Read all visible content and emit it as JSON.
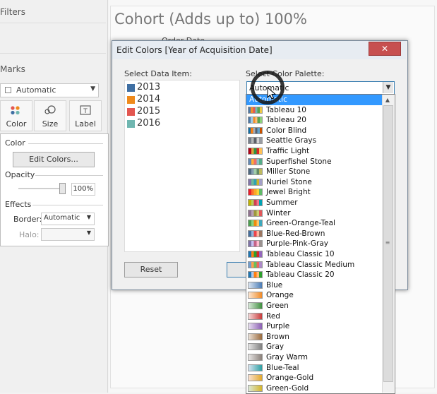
{
  "left_pane": {
    "filters_title": "Filters",
    "marks_title": "Marks",
    "mark_type": "Automatic",
    "mark_buttons": [
      "Color",
      "Size",
      "Label"
    ],
    "color_popup": {
      "color_label": "Color",
      "edit_colors": "Edit Colors...",
      "opacity_label": "Opacity",
      "opacity_value": "100%",
      "opacity_level": 1.0,
      "effects_label": "Effects",
      "border_label": "Border:",
      "border_value": "Automatic",
      "halo_label": "Halo:",
      "halo_value": ""
    }
  },
  "view": {
    "title": "Cohort (Adds up to) 100%",
    "subtitle": "Order Date"
  },
  "dialog": {
    "title": "Edit Colors [Year of Acquisition Date]",
    "close": "✕",
    "select_data_item_label": "Select Data Item:",
    "data_items": [
      {
        "label": "2013",
        "color": "#3f6fa3"
      },
      {
        "label": "2014",
        "color": "#ef8a1b"
      },
      {
        "label": "2015",
        "color": "#e35650"
      },
      {
        "label": "2016",
        "color": "#6fb6b0"
      }
    ],
    "select_palette_label": "Select Color Palette:",
    "palette_value": "Automatic",
    "reset": "Reset",
    "palette_options": [
      {
        "label": "Automatic",
        "colors": [],
        "selected": true
      },
      {
        "label": "Tableau 10",
        "colors": [
          "#4e79a7",
          "#f28e2b",
          "#e15759",
          "#76b7b2",
          "#59a14f",
          "#edc948"
        ]
      },
      {
        "label": "Tableau 20",
        "colors": [
          "#4e79a7",
          "#a0cbe8",
          "#f28e2b",
          "#ffbe7d",
          "#59a14f",
          "#8cd17d"
        ]
      },
      {
        "label": "Color Blind",
        "colors": [
          "#1170aa",
          "#fc7d0b",
          "#a3acb9",
          "#57606c",
          "#5fa2ce",
          "#c85200"
        ]
      },
      {
        "label": "Seattle Grays",
        "colors": [
          "#767f8b",
          "#b3b7b8",
          "#5c6068",
          "#d3d3d3",
          "#989ca3"
        ]
      },
      {
        "label": "Traffic Light",
        "colors": [
          "#b10318",
          "#dba13a",
          "#309343",
          "#d82526",
          "#ffc156"
        ]
      },
      {
        "label": "Superfishel Stone",
        "colors": [
          "#6388b4",
          "#ffae34",
          "#ef6f6a",
          "#8cc2ca",
          "#55ad89"
        ]
      },
      {
        "label": "Miller Stone",
        "colors": [
          "#4f6980",
          "#849db1",
          "#a2ceaa",
          "#638b66",
          "#bfbb60"
        ]
      },
      {
        "label": "Nuriel Stone",
        "colors": [
          "#8175aa",
          "#6fb899",
          "#31a1b3",
          "#ccb22b",
          "#a39fc9"
        ]
      },
      {
        "label": "Jewel Bright",
        "colors": [
          "#eb1e2c",
          "#fd6f30",
          "#f9a729",
          "#f9d23c",
          "#5fbb68"
        ]
      },
      {
        "label": "Summer",
        "colors": [
          "#bfb202",
          "#b9ca5d",
          "#cf3e53",
          "#f1788d",
          "#00a2b3"
        ]
      },
      {
        "label": "Winter",
        "colors": [
          "#90728f",
          "#b9a0b4",
          "#9d983d",
          "#cecb76",
          "#e15759"
        ]
      },
      {
        "label": "Green-Orange-Teal",
        "colors": [
          "#4e9f50",
          "#87d180",
          "#ef8a0c",
          "#fcc66d",
          "#3ca8bc"
        ]
      },
      {
        "label": "Blue-Red-Brown",
        "colors": [
          "#466f9d",
          "#91b3d7",
          "#ed444a",
          "#feb5a2",
          "#9d7660"
        ]
      },
      {
        "label": "Purple-Pink-Gray",
        "colors": [
          "#8074a8",
          "#c6c1f0",
          "#c46487",
          "#ffbed1",
          "#9c9290"
        ]
      },
      {
        "label": "Tableau Classic 10",
        "colors": [
          "#1f77b4",
          "#ff7f0e",
          "#2ca02c",
          "#d62728",
          "#9467bd"
        ]
      },
      {
        "label": "Tableau Classic Medium",
        "colors": [
          "#729ece",
          "#ff9e4a",
          "#67bf5c",
          "#ed665d",
          "#ad8bc9"
        ]
      },
      {
        "label": "Tableau Classic 20",
        "colors": [
          "#1f77b4",
          "#aec7e8",
          "#ff7f0e",
          "#ffbb78",
          "#2ca02c"
        ]
      },
      {
        "label": "Blue",
        "colors": [
          "#4a7cb6",
          "#4a7cb6"
        ]
      },
      {
        "label": "Orange",
        "colors": [
          "#f08a26",
          "#f08a26"
        ]
      },
      {
        "label": "Green",
        "colors": [
          "#3f8f3f",
          "#3f8f3f"
        ]
      },
      {
        "label": "Red",
        "colors": [
          "#c93b3b",
          "#c93b3b"
        ]
      },
      {
        "label": "Purple",
        "colors": [
          "#8b5fb4",
          "#8b5fb4"
        ]
      },
      {
        "label": "Brown",
        "colors": [
          "#9a6a3c",
          "#9a6a3c"
        ]
      },
      {
        "label": "Gray",
        "colors": [
          "#7f7f7f",
          "#7f7f7f"
        ]
      },
      {
        "label": "Gray Warm",
        "colors": [
          "#8a807a",
          "#8a807a"
        ]
      },
      {
        "label": "Blue-Teal",
        "colors": [
          "#3a78b4",
          "#2ca0a3"
        ]
      },
      {
        "label": "Orange-Gold",
        "colors": [
          "#e56b1f",
          "#e2a82b"
        ]
      },
      {
        "label": "Green-Gold",
        "colors": [
          "#4d8f3a",
          "#d4b52b"
        ]
      }
    ]
  }
}
